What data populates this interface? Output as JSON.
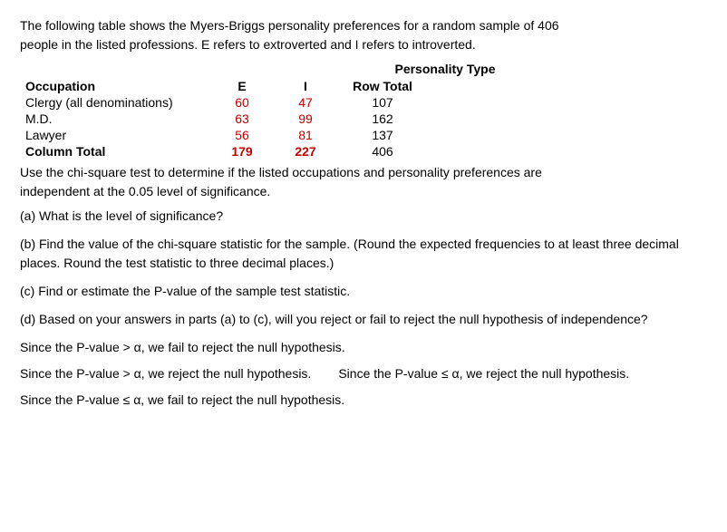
{
  "intro": {
    "line1": "The following table shows the Myers-Briggs personality preferences for a random sample of 406",
    "line2": "people in the listed professions. E refers to extroverted and I refers to introverted."
  },
  "personality_type_header": "Personality Type",
  "table": {
    "headers": {
      "occupation": "Occupation",
      "e": "E",
      "i": "I",
      "row_total": "Row Total"
    },
    "rows": [
      {
        "occupation": "Clergy (all denominations)",
        "e": "60",
        "i": "47",
        "row_total": "107"
      },
      {
        "occupation": "M.D.",
        "e": "63",
        "i": "99",
        "row_total": "162"
      },
      {
        "occupation": "Lawyer",
        "e": "56",
        "i": "81",
        "row_total": "137"
      },
      {
        "occupation": "Column Total",
        "e": "179",
        "i": "227",
        "row_total": "406",
        "bold": true
      }
    ]
  },
  "chi_square_text": {
    "line1": "Use the chi-square test to determine if the listed occupations and personality preferences are",
    "line2": "independent at the 0.05 level of significance."
  },
  "questions": {
    "a": "(a) What is the level of significance?",
    "b": "(b) Find the value of the chi-square statistic for the sample. (Round the expected frequencies to at least three decimal places. Round the test statistic to three decimal places.)",
    "c": "(c) Find or estimate the P-value of the sample test statistic.",
    "d": "(d) Based on your answers in parts (a) to (c), will you reject or fail to reject the null hypothesis of independence?"
  },
  "answers": {
    "a1": "Since the P-value > α, we fail to reject the null hypothesis.",
    "b1": "Since the P-value > α, we reject the null hypothesis.",
    "b2": "Since the P-value ≤ α, we reject the null hypothesis.",
    "c1": "Since the P-value ≤ α, we fail to reject the null hypothesis."
  }
}
